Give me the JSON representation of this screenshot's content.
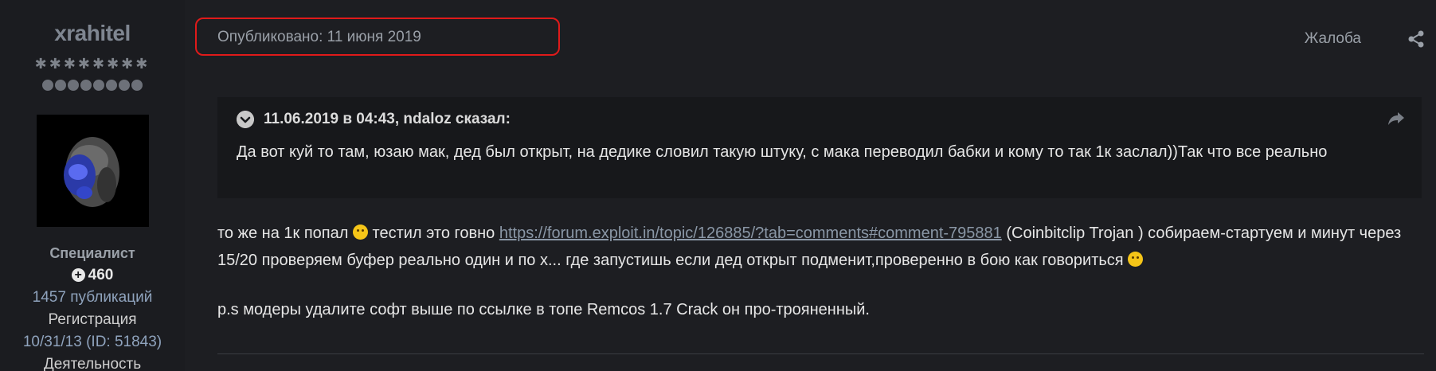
{
  "author": {
    "username": "xrahitel",
    "stars": "✱✱✱✱✱✱✱✱",
    "dots_count": 8,
    "rank": "Специалист",
    "reputation": "460",
    "posts": "1457 публикаций",
    "registration_label": "Регистрация",
    "registration_value": "10/31/13 (ID: 51843)",
    "activity_label": "Деятельность"
  },
  "post": {
    "published": "Опубликовано: 11 июня 2019",
    "report": "Жалоба",
    "share_icon": "share-icon",
    "highlight_color": "#e01a1a",
    "quote": {
      "header": "11.06.2019 в 04:43, ndaloz сказал:",
      "body": "Да вот куй то там, юзаю мак, дед был открыт, на дедике словил такую штуку, с мака переводил бабки и кому то так 1к заслал))Так что все реально"
    },
    "body": {
      "p1_part1": "то же на 1к попал ",
      "p1_part2": " тестил это говно ",
      "link": "https://forum.exploit.in/topic/126885/?tab=comments#comment-795881",
      "p1_part3": "  (Coinbitclip Trojan ) собираем-стартуем и минут через 15/20 проверяем буфер реально один и по х... где запустишь если дед открыт подменит,проверенно в бою как говориться ",
      "p2": "p.s модеры удалите софт выше по ссылке в топе Remcos 1.7 Crack  он про-трояненный."
    }
  }
}
